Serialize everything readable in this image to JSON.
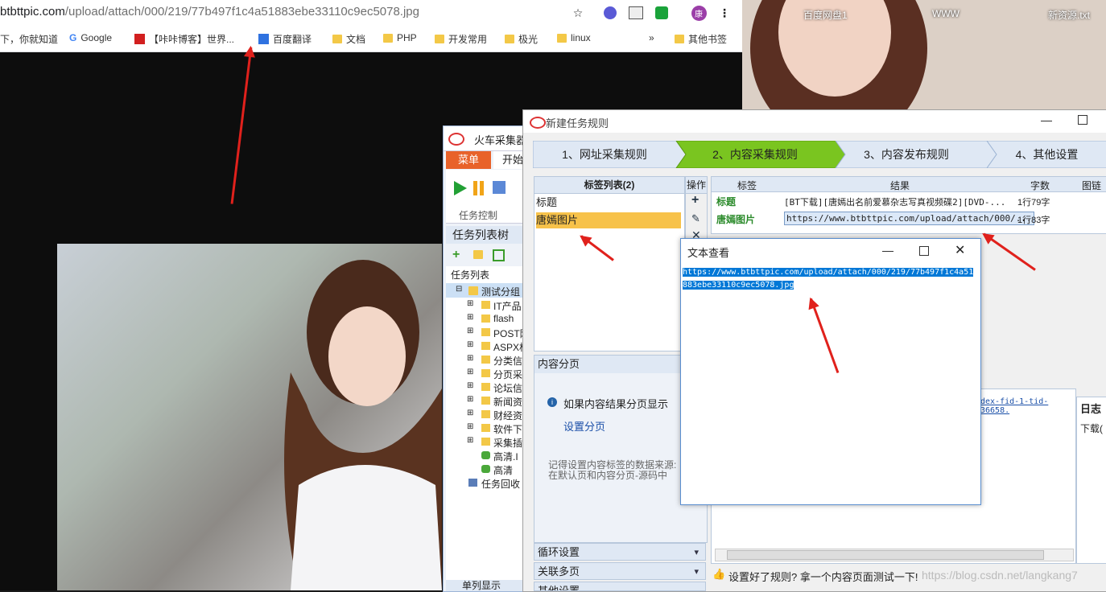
{
  "browser": {
    "url_host": "btbttpic.com",
    "url_path": "/upload/attach/000/219/77b497f1c4a51883ebe33110c9ec5078.jpg",
    "profile_initial": "康",
    "bookmarks": [
      "下，你就知道",
      "Google",
      "【咔咔博客】世界...",
      "百度翻译",
      "文档",
      "PHP",
      "开发常用",
      "极光",
      "linux",
      "»",
      "其他书签"
    ]
  },
  "desktop": {
    "icons": [
      "百度网盘1",
      "WWW",
      "新资源.txt"
    ]
  },
  "locomotive": {
    "title": "火车采集器",
    "tabs": [
      "菜单",
      "开始"
    ],
    "task_control_label": "任务控制",
    "task_tree_title": "任务列表树",
    "task_list_label": "任务列表",
    "root_group": "测试分组",
    "tree_items": [
      "IT产品",
      "flash",
      "POST网",
      "ASPX格",
      "分类信",
      "分页采",
      "论坛信",
      "新闻资",
      "财经资",
      "软件下",
      "采集插",
      "高清.I",
      "高清",
      "任务回收"
    ],
    "bottom_label": "单列显示"
  },
  "rule_window": {
    "title": "新建任务规则",
    "steps": [
      "1、网址采集规则",
      "2、内容采集规则",
      "3、内容发布规则",
      "4、其他设置"
    ],
    "tag_list_header": "标签列表(2)",
    "tags": [
      "标题",
      "唐嫣图片"
    ],
    "op_header": "操作",
    "columns": [
      "标签",
      "结果",
      "字数",
      "图链"
    ],
    "rows": [
      {
        "tag": "标题",
        "result": "[BT下载][唐嫣出名前爱慕杂志写真视频碟2][DVD-...",
        "count": "1行79字"
      },
      {
        "tag": "唐嫣图片",
        "result": "https://www.btbttpic.com/upload/attach/000/...",
        "count": "1行83字"
      }
    ],
    "content_pages_header": "内容分页",
    "page_info": "如果内容结果分页显示",
    "page_link": "设置分页",
    "page_hint": "记得设置内容标签的数据来源:\n在默认页和内容分页-源码中",
    "collapsibles": [
      "循环设置",
      "关联多页",
      "其他设置"
    ],
    "log_header": "日志",
    "log_text": "下载(",
    "link_fragment": "dex-fid-1-tid-36658.",
    "test_prompt": "设置好了规则? 拿一个内容页面测试一下!",
    "watermark": "https://blog.csdn.net/langkang7"
  },
  "viewer": {
    "title": "文本查看",
    "line1": "https://www.btbttpic.com/upload/attach/000/219/77b497f1c4a51",
    "line2": "883ebe33110c9ec5078.jpg"
  },
  "colors": {
    "accent": "#7ac520",
    "selection": "#0078d7",
    "arrow": "#e0211c",
    "tag_green": "#2a8a2a"
  }
}
